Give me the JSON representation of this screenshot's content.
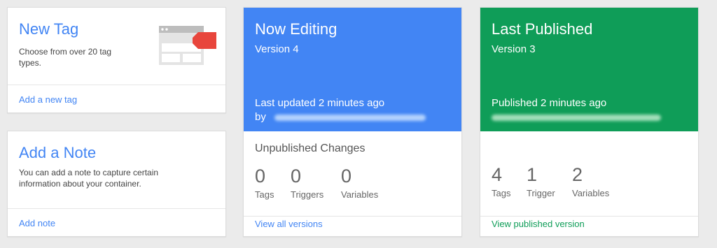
{
  "new_tag": {
    "title": "New Tag",
    "description": "Choose from over 20 tag types.",
    "link": "Add a new tag"
  },
  "add_note": {
    "title": "Add a Note",
    "description": "You can add a note to capture certain information about your container.",
    "link": "Add note"
  },
  "now_editing": {
    "title": "Now Editing",
    "version": "Version 4",
    "status_line1": "Last updated 2 minutes ago",
    "status_by": "by",
    "color": "#4285f4",
    "section_title": "Unpublished Changes",
    "stats": [
      {
        "value": "0",
        "label": "Tags"
      },
      {
        "value": "0",
        "label": "Triggers"
      },
      {
        "value": "0",
        "label": "Variables"
      }
    ],
    "link": "View all versions",
    "link_color": "#4285f4"
  },
  "last_published": {
    "title": "Last Published",
    "version": "Version 3",
    "status_line1": "Published 2 minutes ago",
    "color": "#0f9d58",
    "stats": [
      {
        "value": "4",
        "label": "Tags"
      },
      {
        "value": "1",
        "label": "Trigger"
      },
      {
        "value": "2",
        "label": "Variables"
      }
    ],
    "link": "View published version",
    "link_color": "#0f9d58"
  }
}
